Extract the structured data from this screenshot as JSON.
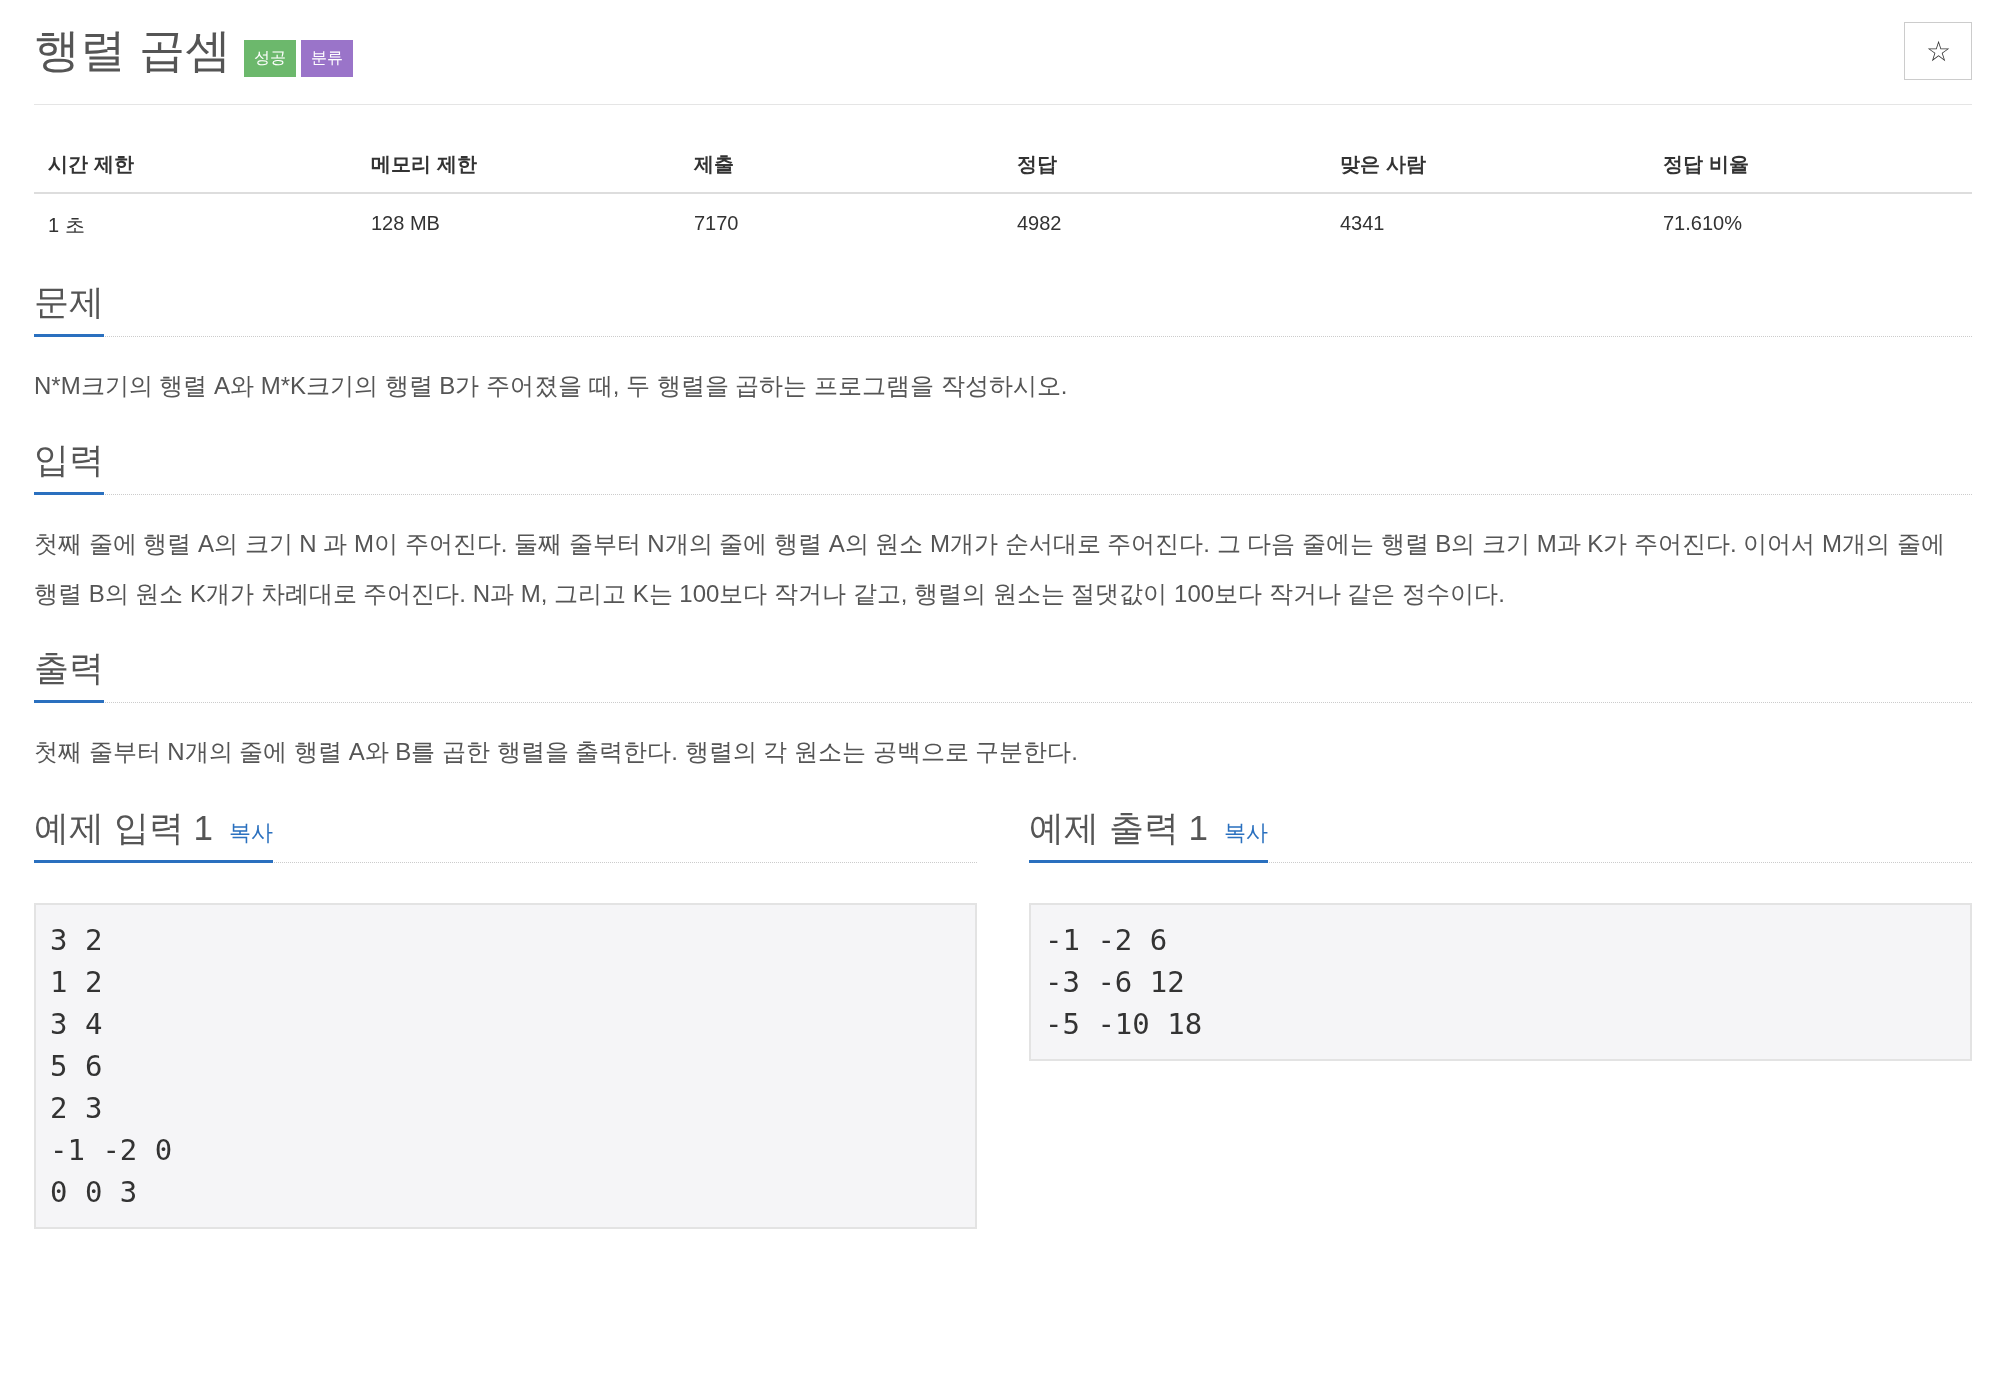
{
  "title": "행렬 곱셈",
  "badges": [
    {
      "label": "성공",
      "color": "#6cb86c"
    },
    {
      "label": "분류",
      "color": "#9a74c9"
    }
  ],
  "star_button": "☆",
  "stats": {
    "columns": [
      "시간 제한",
      "메모리 제한",
      "제출",
      "정답",
      "맞은 사람",
      "정답 비율"
    ],
    "row": [
      "1 초",
      "128 MB",
      "7170",
      "4982",
      "4341",
      "71.610%"
    ]
  },
  "sections": [
    {
      "heading": "문제",
      "text": "N*M크기의 행렬 A와 M*K크기의 행렬 B가 주어졌을 때, 두 행렬을 곱하는 프로그램을 작성하시오."
    },
    {
      "heading": "입력",
      "text": "첫째 줄에 행렬 A의 크기 N 과 M이 주어진다. 둘째 줄부터 N개의 줄에 행렬 A의 원소 M개가 순서대로 주어진다. 그 다음 줄에는 행렬 B의 크기 M과 K가 주어진다. 이어서 M개의 줄에 행렬 B의 원소 K개가 차례대로 주어진다. N과 M, 그리고 K는 100보다 작거나 같고, 행렬의 원소는 절댓값이 100보다 작거나 같은 정수이다."
    },
    {
      "heading": "출력",
      "text": "첫째 줄부터 N개의 줄에 행렬 A와 B를 곱한 행렬을 출력한다. 행렬의 각 원소는 공백으로 구분한다."
    }
  ],
  "samples": [
    {
      "heading": "예제 입력 1",
      "copy": "복사",
      "lines": [
        "3 2",
        "1 2",
        "3 4",
        "5 6",
        "2 3",
        "-1 -2 0",
        "0 0 3"
      ]
    },
    {
      "heading": "예제 출력 1",
      "copy": "복사",
      "lines": [
        "-1 -2 6",
        "-3 -6 12",
        "-5 -10 18"
      ]
    }
  ]
}
